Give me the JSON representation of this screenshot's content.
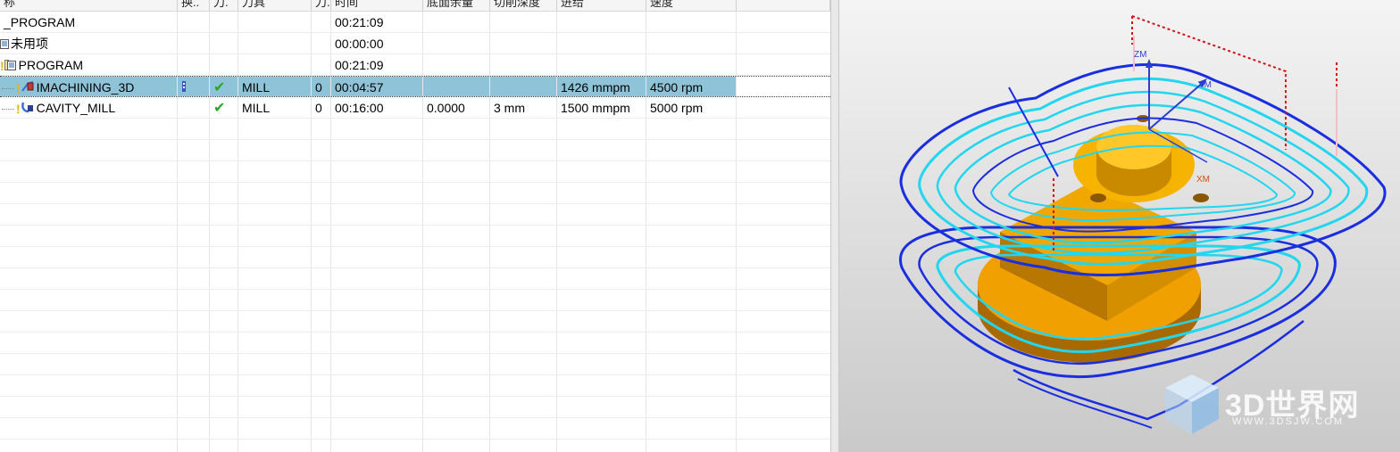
{
  "columns": [
    "称",
    "换..",
    "刀.",
    "刀具",
    "刀.",
    "时间",
    "底面余量",
    "切削深度",
    "进给",
    "速度"
  ],
  "rows": [
    {
      "name": "_PROGRAM",
      "swap": "",
      "path": "",
      "tool": "",
      "tool_num": "",
      "time": "00:21:09",
      "stock": "",
      "depth": "",
      "feed": "",
      "speed": ""
    },
    {
      "name": "未用项",
      "swap": "",
      "path": "",
      "tool": "",
      "tool_num": "",
      "time": "00:00:00",
      "stock": "",
      "depth": "",
      "feed": "",
      "speed": ""
    },
    {
      "name": "PROGRAM",
      "swap": "",
      "path": "",
      "tool": "",
      "tool_num": "",
      "time": "00:21:09",
      "stock": "",
      "depth": "",
      "feed": "",
      "speed": ""
    },
    {
      "name": "IMACHINING_3D",
      "swap": "",
      "path": "✔",
      "tool": "MILL",
      "tool_num": "0",
      "time": "00:04:57",
      "stock": "",
      "depth": "",
      "feed": "1426 mmpm",
      "speed": "4500 rpm"
    },
    {
      "name": "CAVITY_MILL",
      "swap": "",
      "path": "✔",
      "tool": "MILL",
      "tool_num": "0",
      "time": "00:16:00",
      "stock": "0.0000",
      "depth": "3 mm",
      "feed": "1500 mmpm",
      "speed": "5000 rpm"
    }
  ],
  "viewport": {
    "axis_labels": {
      "zm": "ZM",
      "ym": "YM",
      "xm": "XM"
    }
  },
  "watermark": {
    "title": "3D世界网",
    "url": "WWW.3DSJW.COM"
  },
  "colors": {
    "selection": "#8fc4d8",
    "toolpath_blue": "#1a2ee0",
    "toolpath_cyan": "#22d6f0",
    "part_orange": "#f0a000",
    "check_green": "#2aa82a"
  }
}
